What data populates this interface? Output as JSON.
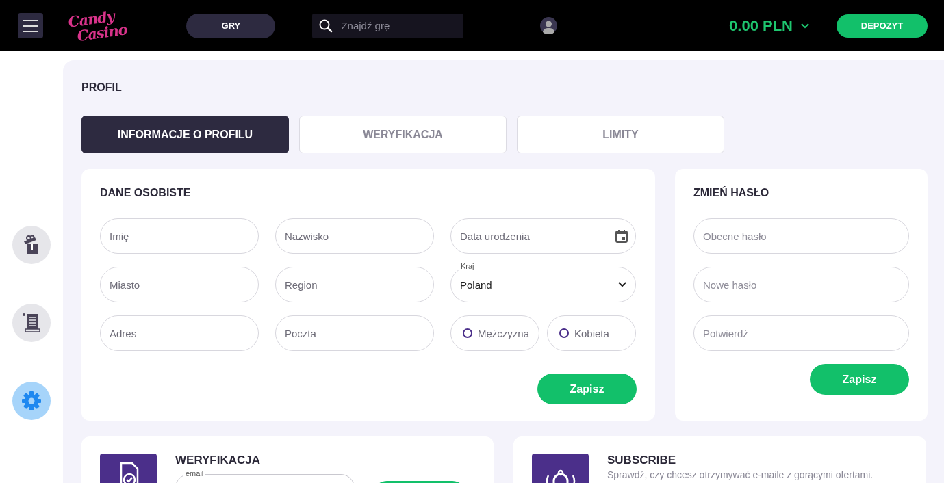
{
  "header": {
    "logo": [
      "Candy",
      "Casino"
    ],
    "games_button": "GRY",
    "search": {
      "placeholder": "Znajdź grę"
    },
    "balance": "0.00 PLN",
    "deposit_button": "DEPOZYT"
  },
  "sidebar": {
    "items": [
      {
        "kind": "gift",
        "selected": false
      },
      {
        "kind": "scroll",
        "selected": false
      },
      {
        "kind": "settings",
        "selected": true
      }
    ]
  },
  "page_title": "PROFIL",
  "tabs": [
    {
      "label": "INFORMACJE O PROFILU",
      "selected": true
    },
    {
      "label": "WERYFIKACJA",
      "selected": false
    },
    {
      "label": "LIMITY",
      "selected": false
    }
  ],
  "personal": {
    "title": "DANE OSOBISTE",
    "fields": [
      {
        "kind": "text",
        "placeholder": "Imię"
      },
      {
        "kind": "text",
        "placeholder": "Nazwisko"
      },
      {
        "kind": "date",
        "placeholder": "Data urodzenia"
      },
      {
        "kind": "text",
        "placeholder": "Miasto"
      },
      {
        "kind": "text",
        "placeholder": "Region"
      },
      {
        "kind": "select",
        "label": "Kraj",
        "value": "Poland"
      },
      {
        "kind": "text",
        "placeholder": "Adres"
      },
      {
        "kind": "text",
        "placeholder": "Poczta"
      },
      {
        "kind": "gender",
        "options": [
          {
            "label": "Mężczyzna",
            "selected": false
          },
          {
            "label": "Kobieta",
            "selected": false
          }
        ]
      }
    ],
    "save_button": "Zapisz"
  },
  "password": {
    "title": "ZMIEŃ HASŁO",
    "fields": [
      {
        "placeholder": "Obecne hasło"
      },
      {
        "placeholder": "Nowe hasło"
      },
      {
        "placeholder": "Potwierdź"
      }
    ],
    "save_button": "Zapisz"
  },
  "verification": {
    "title": "WERYFIKACJA",
    "email_label": "email"
  },
  "subscribe": {
    "title": "SUBSCRIBE",
    "text": "Sprawdź, czy chcesz otrzymywać e-maile z gorącymi ofertami."
  }
}
